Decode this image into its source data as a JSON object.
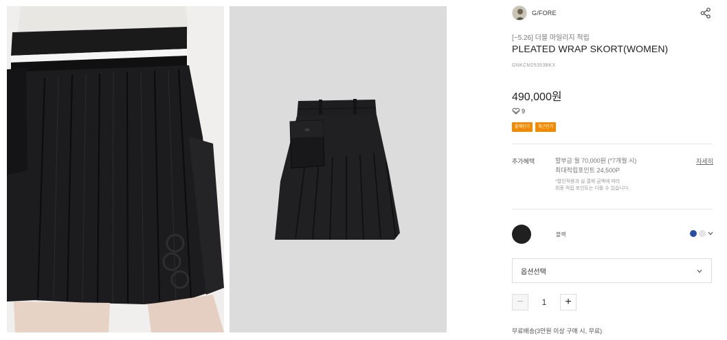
{
  "brand": {
    "name": "G/FORE",
    "avatar_icon": "brand-avatar-icon"
  },
  "product": {
    "promo": "[~5.26] 더블 마일리지 적립",
    "title": "PLEATED WRAP SKORT(WOMEN)",
    "code": "GNKCM25353BKX",
    "price": "490,000원",
    "likes": "9",
    "badges": [
      "올해인기",
      "최근인기"
    ]
  },
  "benefits": {
    "label": "추가혜택",
    "line1": "할부금 월 70,000원 (*7개월 시)",
    "line2": "최대적립포인트 24,500P",
    "note1": "*할인적용과 실 결제 금액에 따라",
    "note2": "최종 적립 포인트는 다를 수 있습니다.",
    "detail_link": "자세히"
  },
  "color": {
    "selected_label": "블랙",
    "primary": "#202020",
    "swatches": [
      "#2b4ea0",
      "#e6e6e6"
    ]
  },
  "options": {
    "select_label": "옵션선택"
  },
  "quantity": {
    "value": "1",
    "minus": "−",
    "plus": "+"
  },
  "shipping": {
    "text": "무료배송(3만원 이상 구매 시, 무료)"
  }
}
